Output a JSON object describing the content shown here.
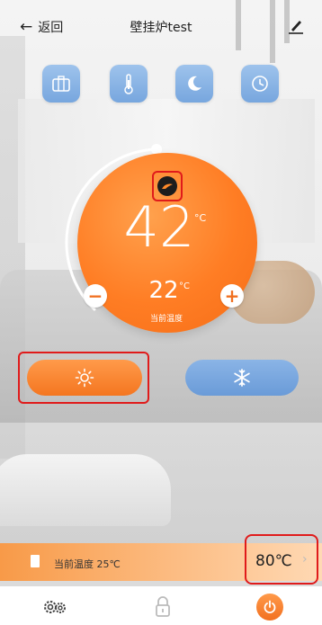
{
  "header": {
    "back_label": "返回",
    "title": "壁挂炉test"
  },
  "modes": [
    {
      "name": "suitcase-icon"
    },
    {
      "name": "thermometer-icon"
    },
    {
      "name": "moon-icon"
    },
    {
      "name": "clock-icon"
    }
  ],
  "dial": {
    "set_temperature": "42",
    "set_unit": "°C",
    "current_temperature": "22",
    "current_unit": "°C",
    "current_label": "当前温度",
    "minus": "−",
    "plus": "+"
  },
  "controls": {
    "heat_icon": "sun-icon",
    "cool_icon": "snowflake-icon"
  },
  "status": {
    "current_text": "当前温度 25℃",
    "water_temperature": "80℃",
    "chevron": "›"
  },
  "colors": {
    "accent": "#f57a22",
    "mode_blue": "#86b2e6",
    "highlight": "#e01b1b"
  }
}
